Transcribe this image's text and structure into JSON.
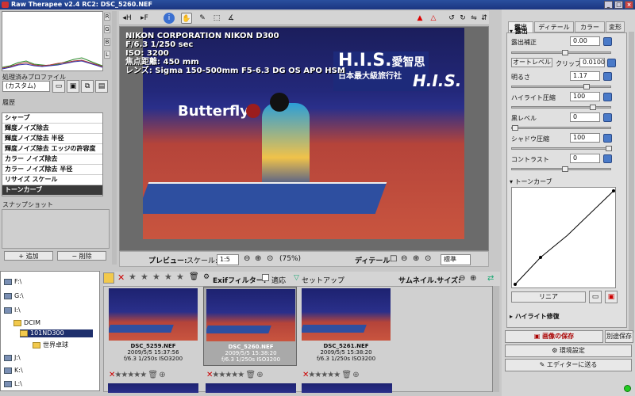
{
  "window": {
    "title": "Raw Therapee v2.4 RC2: DSC_5260.NEF"
  },
  "histogram": {
    "channels": [
      "R",
      "G",
      "B",
      "L"
    ]
  },
  "profile": {
    "label": "処理済みプロファイル",
    "value": "(カスタム)"
  },
  "history": {
    "label": "履歴",
    "items": [
      "シャープ",
      "輝度ノイズ除去",
      "輝度ノイズ除去 半径",
      "輝度ノイズ除去 エッジの許容度",
      "カラー ノイズ除去",
      "カラー ノイズ除去 半径",
      "リサイズ スケール",
      "トーンカーブ"
    ],
    "selected_index": 7
  },
  "snapshot": {
    "label": "スナップショット",
    "add_label": "追加",
    "delete_label": "削除"
  },
  "exif_overlay": {
    "lines": [
      "NIKON CORPORATION NIKON D300",
      "F/6.3 1/250 sec",
      "ISO: 3200",
      "焦点距離: 450 mm",
      "レンズ: Sigma 150-500mm F5-6.3 DG OS APO HSM"
    ]
  },
  "photo_text": {
    "his_brand": "H.I.S.",
    "his_jp": "愛智思",
    "his_sub": "日本最大級旅行社",
    "butterfly": "Butterfly",
    "brand_right": "H.I.S."
  },
  "preview_bar": {
    "preview_label": "プレビュー:",
    "scale_label": "スケール:",
    "scale_value": "1:5",
    "zoom_pct": "(75%)",
    "detail_label": "ディテール",
    "detail_value": "標準"
  },
  "file_browser": {
    "exif_filter_label": "Exifフィルター:",
    "apply_label": "適応",
    "setup_label": "セットアップ",
    "thumb_size_label": "サムネイル.サイズ:",
    "thumbs": [
      {
        "name": "DSC_5259.NEF",
        "date": "2009/5/5 15:37:56",
        "info": "f/6.3 1/250s ISO3200"
      },
      {
        "name": "DSC_5260.NEF",
        "date": "2009/5/5 15:38:20",
        "info": "f/6.3 1/250s ISO3200"
      },
      {
        "name": "DSC_5261.NEF",
        "date": "2009/5/5 15:38:20",
        "info": "f/6.3 1/250s ISO3200"
      }
    ]
  },
  "tree": {
    "nodes": [
      "F:\\",
      "G:\\",
      "I:\\",
      "DCIM",
      "101ND300",
      "世界卓球",
      "J:\\",
      "K:\\",
      "L:\\"
    ]
  },
  "right_panel": {
    "tabs": [
      "露出",
      "ディテール",
      "カラー",
      "変形"
    ],
    "exposure_section": "露出",
    "fields": [
      {
        "label": "露出補正",
        "value": "0.00"
      },
      {
        "label": "明るさ",
        "value": "1.17"
      },
      {
        "label": "ハイライト圧縮",
        "value": "100"
      },
      {
        "label": "黒レベル",
        "value": "0"
      },
      {
        "label": "シャドウ圧縮",
        "value": "100"
      },
      {
        "label": "コントラスト",
        "value": "0"
      }
    ],
    "auto_level_label": "オートレベル",
    "clip_label": "クリップ",
    "clip_value": "0.0100",
    "tone_curve_section": "トーンカーブ",
    "curve_type": "リニア",
    "highlight_section": "ハイライト修復",
    "save_button": "画像の保存",
    "save_as_button": "別途保存",
    "prefs_button": "環境設定",
    "editor_button": "エディターに送る"
  }
}
